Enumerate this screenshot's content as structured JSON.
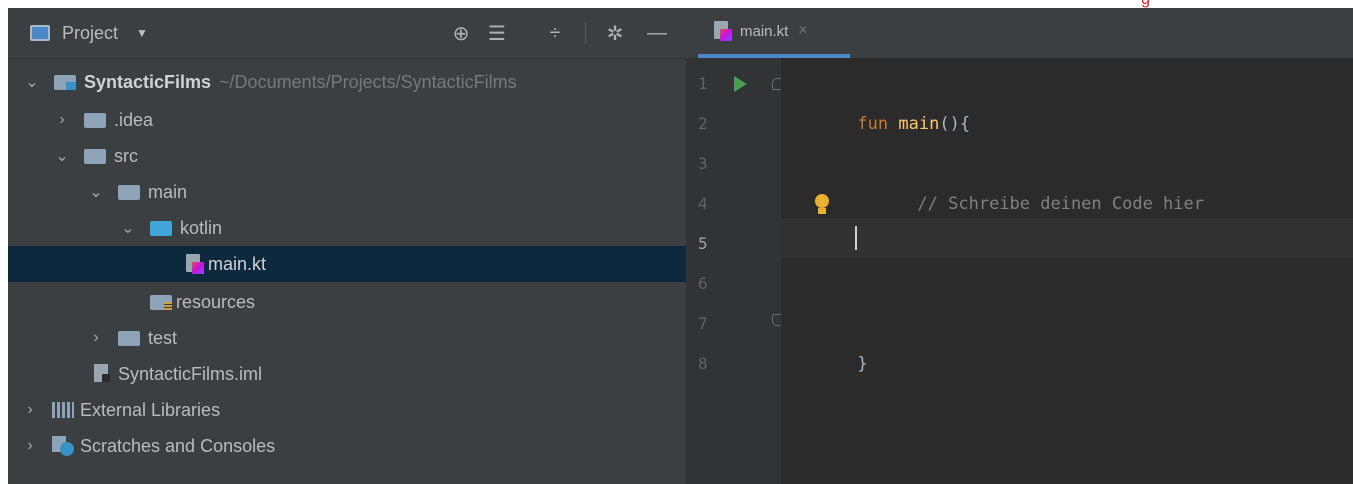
{
  "top_strip": {
    "mark": "g"
  },
  "panel": {
    "title": "Project",
    "dropdown_glyph": "▼"
  },
  "header_icons": [
    {
      "name": "locate-icon",
      "glyph": "⊕"
    },
    {
      "name": "expand-all-icon",
      "glyph": "☰"
    },
    {
      "name": "collapse-all-icon",
      "glyph": "÷"
    },
    {
      "name": "gear-icon",
      "glyph": "✲"
    },
    {
      "name": "minimize-icon",
      "glyph": "—"
    }
  ],
  "tree": {
    "root_name": "SyntacticFilms",
    "root_path": "~/Documents/Projects/SyntacticFilms",
    "idea": ".idea",
    "src": "src",
    "main": "main",
    "kotlin": "kotlin",
    "main_kt": "main.kt",
    "resources": "resources",
    "test": "test",
    "iml": "SyntacticFilms.iml",
    "external_libraries": "External Libraries",
    "scratches": "Scratches and Consoles"
  },
  "editor": {
    "tab_label": "main.kt",
    "tab_close": "×",
    "line_numbers": [
      "1",
      "2",
      "3",
      "4",
      "5",
      "6",
      "7",
      "8"
    ],
    "current_line": "5",
    "code": {
      "l1_kw": "fun",
      "l1_fn": "main",
      "l1_rest": "(){",
      "l3_comment": "// Schreibe deinen Code hier",
      "l7_brace": "}"
    }
  },
  "colors": {
    "panel_bg": "#3c3f41",
    "editor_bg": "#2b2b2b",
    "selection": "#0d293e",
    "keyword": "#cc7832",
    "function": "#ffc66d",
    "comment": "#808080",
    "accent": "#4a88c7"
  }
}
